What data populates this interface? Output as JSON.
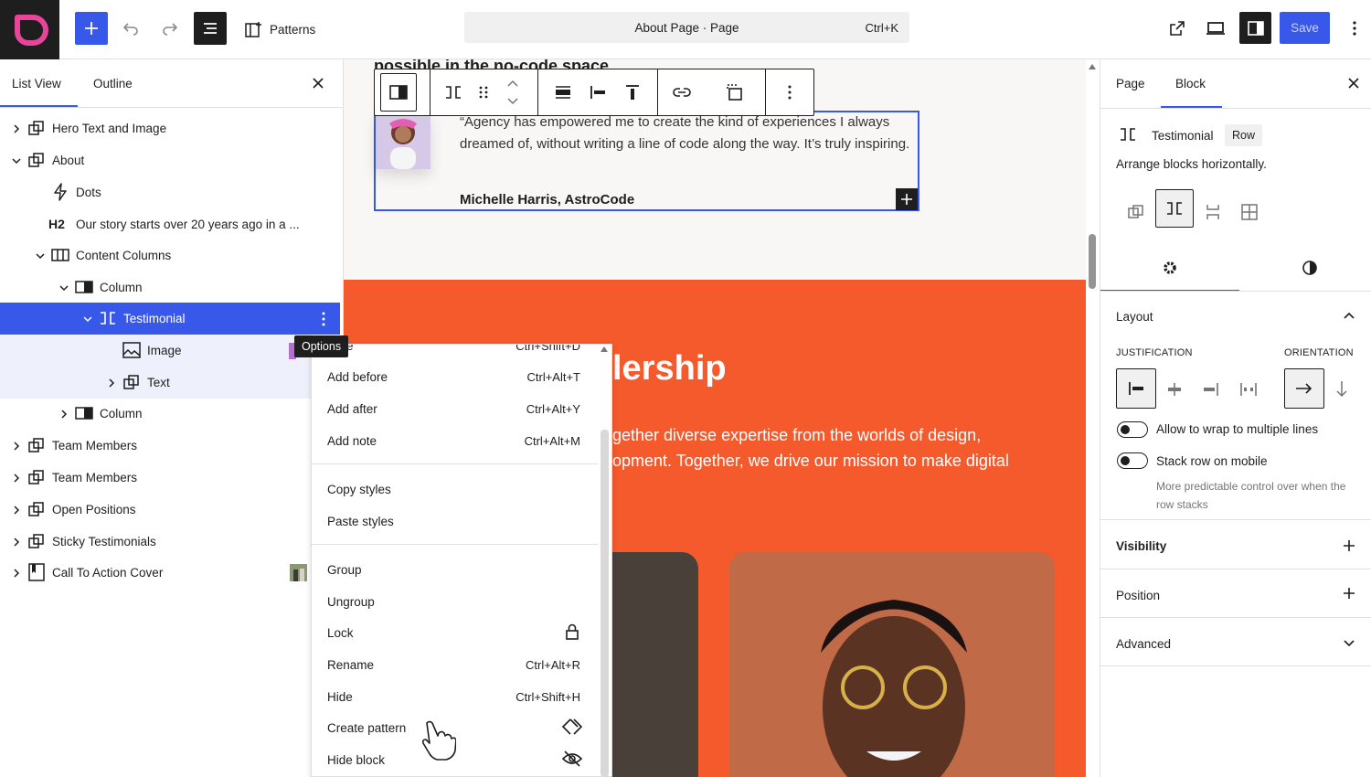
{
  "topbar": {
    "patterns_label": "Patterns",
    "command_title": "About Page · Page",
    "command_shortcut": "Ctrl+K",
    "save_label": "Save"
  },
  "left_panel": {
    "tabs": [
      "List View",
      "Outline"
    ],
    "items": [
      {
        "label": "Hero Text and Image",
        "icon": "group-icon",
        "chevron": "right"
      },
      {
        "label": "About",
        "icon": "group-icon",
        "chevron": "down"
      },
      {
        "label": "Dots",
        "icon": "bolt-icon",
        "chevron": ""
      },
      {
        "label": "Our story starts over 20 years ago in a ...",
        "icon": "heading-h2-icon",
        "chevron": "",
        "icon_text": "H2"
      },
      {
        "label": "Content Columns",
        "icon": "columns-icon",
        "chevron": "down"
      },
      {
        "label": "Column",
        "icon": "column-icon",
        "chevron": "down"
      },
      {
        "label": "Testimonial",
        "icon": "row-icon",
        "chevron": "down",
        "selected": true
      },
      {
        "label": "Image",
        "icon": "image-icon",
        "chevron": ""
      },
      {
        "label": "Text",
        "icon": "group-icon",
        "chevron": "right"
      },
      {
        "label": "Column",
        "icon": "column-icon",
        "chevron": "right"
      },
      {
        "label": "Team Members",
        "icon": "group-icon",
        "chevron": "right"
      },
      {
        "label": "Team Members",
        "icon": "group-icon",
        "chevron": "right"
      },
      {
        "label": "Open Positions",
        "icon": "group-icon",
        "chevron": "right"
      },
      {
        "label": "Sticky Testimonials",
        "icon": "group-icon",
        "chevron": "right"
      },
      {
        "label": "Call To Action Cover",
        "icon": "cover-icon",
        "chevron": "right"
      }
    ],
    "tooltip": "Options"
  },
  "options_menu": {
    "partial_top": {
      "label": "icate",
      "shortcut": "Ctrl+Shift+D"
    },
    "groups": [
      [
        {
          "label": "Add before",
          "shortcut": "Ctrl+Alt+T"
        },
        {
          "label": "Add after",
          "shortcut": "Ctrl+Alt+Y"
        },
        {
          "label": "Add note",
          "shortcut": "Ctrl+Alt+M"
        }
      ],
      [
        {
          "label": "Copy styles",
          "shortcut": ""
        },
        {
          "label": "Paste styles",
          "shortcut": ""
        }
      ],
      [
        {
          "label": "Group",
          "shortcut": ""
        },
        {
          "label": "Ungroup",
          "shortcut": ""
        },
        {
          "label": "Lock",
          "shortcut": "",
          "icon": "lock-icon"
        },
        {
          "label": "Rename",
          "shortcut": "Ctrl+Alt+R"
        },
        {
          "label": "Hide",
          "shortcut": "Ctrl+Shift+H"
        },
        {
          "label": "Create pattern",
          "shortcut": "",
          "icon": "symbol-icon"
        },
        {
          "label": "Hide block",
          "shortcut": "",
          "icon": "hidden-icon"
        }
      ]
    ]
  },
  "canvas": {
    "partial_heading": "possible in the no-code space",
    "quote": "“Agency has empowered me to create the kind of experiences I always dreamed of, without writing a line of code along the way. It’s truly inspiring.",
    "author": "Michelle Harris, AstroCode",
    "section_heading": "lership",
    "section_text_1": "gether diverse expertise from the worlds of design,",
    "section_text_2": "opment. Together, we drive our mission to make digital",
    "accent_color": "#f55a2c"
  },
  "right_panel": {
    "tabs": [
      "Page",
      "Block"
    ],
    "block_name": "Testimonial",
    "block_badge": "Row",
    "block_description": "Arrange blocks horizontally.",
    "layout_title": "Layout",
    "justification_label": "JUSTIFICATION",
    "orientation_label": "ORIENTATION",
    "wrap_label": "Allow to wrap to multiple lines",
    "stack_label": "Stack row on mobile",
    "stack_help": "More predictable control over when the row stacks",
    "sections": [
      "Visibility",
      "Position",
      "Advanced"
    ]
  },
  "colors": {
    "accent": "#3858e9",
    "dark": "#1e1e1e"
  }
}
